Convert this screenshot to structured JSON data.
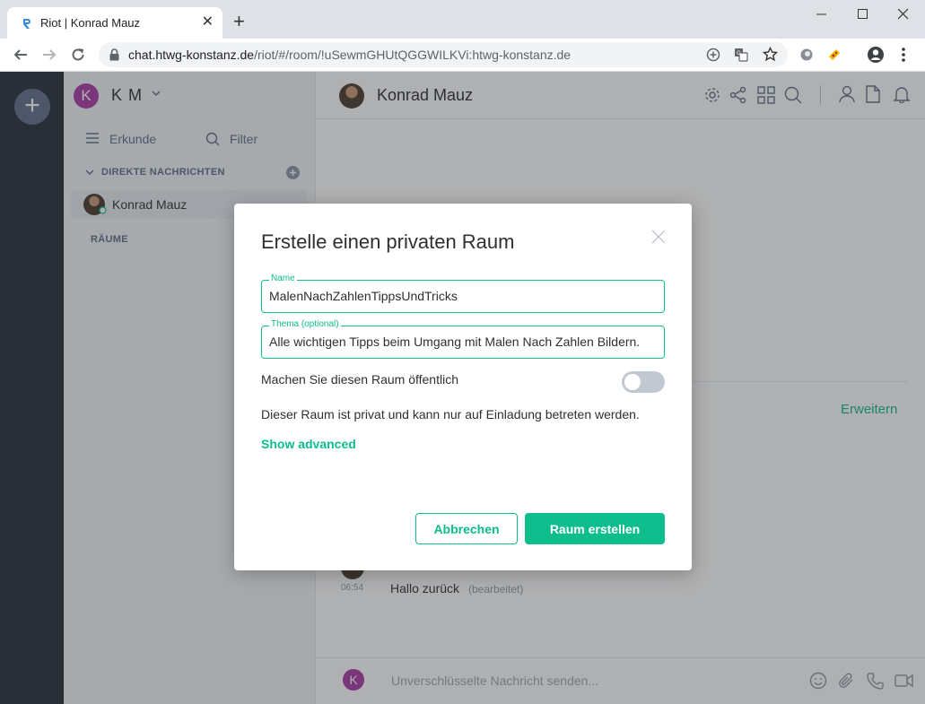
{
  "browser": {
    "tab_title": "Riot | Konrad Mauz",
    "new_tab": "+",
    "url_host": "chat.htwg-konstanz.de",
    "url_path": "/riot/#/room/!uSewmGHUtQGGWILKVi:htwg-konstanz.de"
  },
  "sidebar": {
    "user_avatar_letter": "K",
    "user_name": "K M",
    "explore_label": "Erkunde",
    "filter_label": "Filter",
    "dm_section_title": "DIREKTE NACHRICHTEN",
    "dm_items": [
      {
        "name": "Konrad Mauz"
      }
    ],
    "rooms_section_title": "RÄUME"
  },
  "room": {
    "header_name": "Konrad Mauz",
    "expand_label": "Erweitern",
    "message_time": "06:54",
    "message_text": "Hallo zurück",
    "message_edited": "(bearbeitet)",
    "composer_avatar_letter": "K",
    "composer_placeholder": "Unverschlüsselte Nachricht senden..."
  },
  "dialog": {
    "title": "Erstelle einen privaten Raum",
    "name_label": "Name",
    "name_value": "MalenNachZahlenTippsUndTricks",
    "topic_label": "Thema (optional)",
    "topic_value": "Alle wichtigen Tipps beim Umgang mit Malen Nach Zahlen Bildern.",
    "public_toggle_label": "Machen Sie diesen Raum öffentlich",
    "public_toggle_on": false,
    "private_info": "Dieser Raum ist privat und kann nur auf Einladung betreten werden.",
    "show_advanced": "Show advanced",
    "cancel_button": "Abbrechen",
    "create_button": "Raum erstellen"
  },
  "colors": {
    "accent": "#0dbd8b",
    "rail_bg": "#27303a",
    "avatar_purple": "#ac3ba8"
  }
}
